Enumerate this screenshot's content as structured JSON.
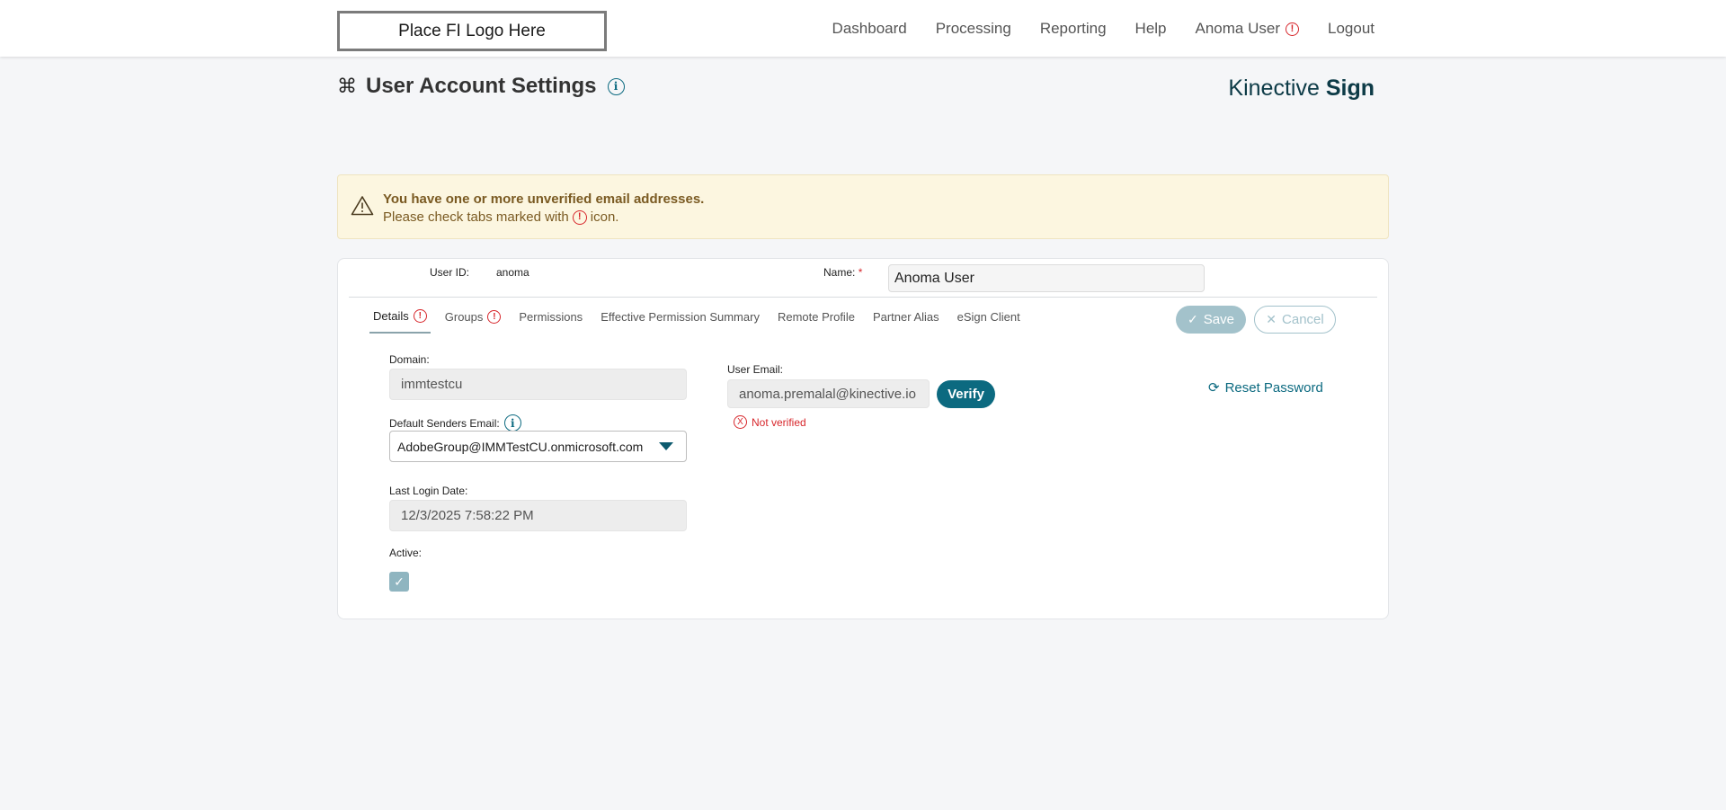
{
  "header": {
    "logo_text": "Place FI Logo Here",
    "nav": {
      "dashboard": "Dashboard",
      "processing": "Processing",
      "reporting": "Reporting",
      "help": "Help",
      "user": "Anoma User",
      "logout": "Logout"
    }
  },
  "page": {
    "title": "User Account Settings",
    "brand_light": "Kinective",
    "brand_bold": "Sign"
  },
  "warning": {
    "line1": "You have one or more unverified email addresses.",
    "line2_prefix": "Please check tabs marked with",
    "line2_suffix": "icon."
  },
  "user": {
    "id_label": "User ID:",
    "id_value": "anoma",
    "name_label": "Name:",
    "name_required": "*",
    "name_value": "Anoma User"
  },
  "tabs": [
    {
      "label": "Details"
    },
    {
      "label": "Groups"
    },
    {
      "label": "Permissions"
    },
    {
      "label": "Effective Permission Summary"
    },
    {
      "label": "Remote Profile"
    },
    {
      "label": "Partner Alias"
    },
    {
      "label": "eSign Client"
    }
  ],
  "actions": {
    "save": "Save",
    "cancel": "Cancel"
  },
  "details": {
    "domain_label": "Domain:",
    "domain_value": "immtestcu",
    "senders_label": "Default Senders Email:",
    "senders_value": "AdobeGroup@IMMTestCU.onmicrosoft.com",
    "last_login_label": "Last Login Date:",
    "last_login_value": "12/3/2025 7:58:22 PM",
    "active_label": "Active:",
    "active": true,
    "email_label": "User Email:",
    "email_value": "anoma.premalal@kinective.io",
    "verify": "Verify",
    "not_verified": "Not verified",
    "reset_password": "Reset Password"
  },
  "colors": {
    "accent": "#0c6a80",
    "alert": "#d7262b",
    "warning_bg": "#fcf6e0",
    "warning_text": "#7a5a22"
  },
  "icons": {
    "alert": "exclamation-circle",
    "info": "info-circle",
    "command": "command-key",
    "warning": "warning-triangle",
    "check": "checkmark",
    "close": "x",
    "reset": "refresh-circle",
    "caret": "caret-down"
  }
}
